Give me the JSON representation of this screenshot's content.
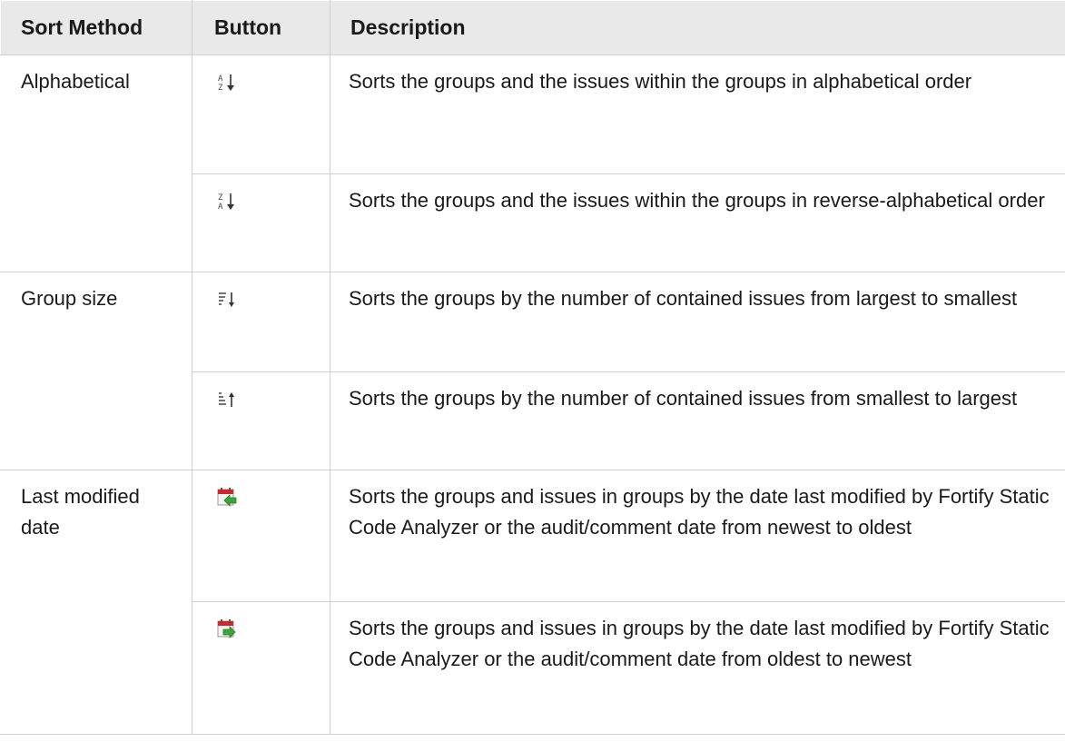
{
  "table": {
    "headers": {
      "method": "Sort Method",
      "button": "Button",
      "description": "Description"
    },
    "groups": [
      {
        "method": "Alphabetical",
        "rows": [
          {
            "icon": "sort-a-z-icon",
            "description": "Sorts the groups and the issues within the groups in alphabetical order"
          },
          {
            "icon": "sort-z-a-icon",
            "description": "Sorts the groups and the issues within the groups in reverse-alphabetical order"
          }
        ]
      },
      {
        "method": "Group size",
        "rows": [
          {
            "icon": "sort-size-descending-icon",
            "description": "Sorts the groups by the number of contained issues from largest to smallest"
          },
          {
            "icon": "sort-size-ascending-icon",
            "description": "Sorts the groups by the number of contained issues from smallest to largest"
          }
        ]
      },
      {
        "method": "Last modified date",
        "rows": [
          {
            "icon": "calendar-newest-first-icon",
            "description": "Sorts the groups and issues in groups by the date last modified by Fortify Static Code Analyzer or the audit/comment date from newest to oldest"
          },
          {
            "icon": "calendar-oldest-first-icon",
            "description": "Sorts the groups and issues in groups by the date last modified by Fortify Static Code Analyzer or the audit/comment date from oldest to newest"
          }
        ]
      }
    ]
  }
}
